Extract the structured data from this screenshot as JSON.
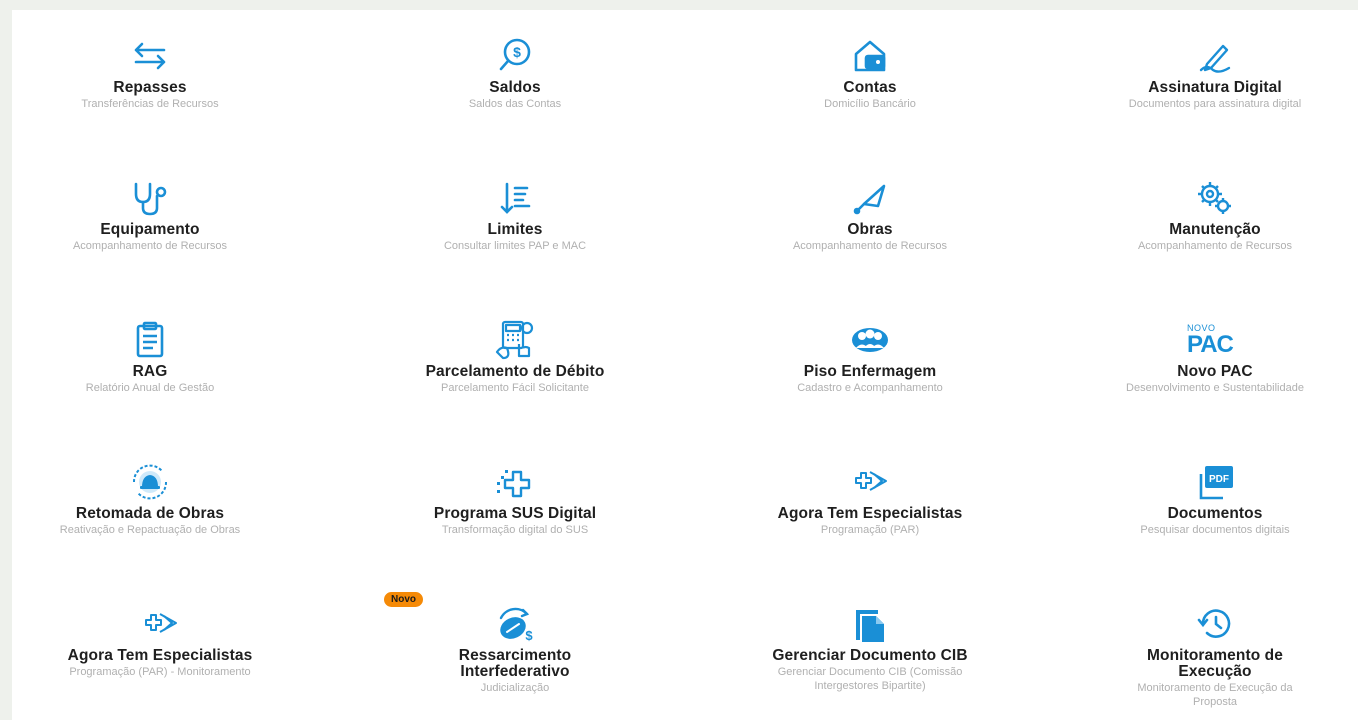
{
  "accent_color": "#1a8fd6",
  "badge": {
    "label": "Novo"
  },
  "tiles": [
    {
      "title": "Repasses",
      "subtitle": "Transferências de Recursos",
      "icon": "transfer-arrows-icon"
    },
    {
      "title": "Saldos",
      "subtitle": "Saldos das Contas",
      "icon": "balance-search-icon"
    },
    {
      "title": "Contas",
      "subtitle": "Domicílio Bancário",
      "icon": "house-wallet-icon"
    },
    {
      "title": "Assinatura Digital",
      "subtitle": "Documentos para assinatura digital",
      "icon": "signature-pen-icon"
    },
    {
      "title": "Equipamento",
      "subtitle": "Acompanhamento de Recursos",
      "icon": "stethoscope-icon"
    },
    {
      "title": "Limites",
      "subtitle": "Consultar limites PAP e MAC",
      "icon": "sort-list-icon"
    },
    {
      "title": "Obras",
      "subtitle": "Acompanhamento de Recursos",
      "icon": "trowel-icon"
    },
    {
      "title": "Manutenção",
      "subtitle": "Acompanhamento de Recursos",
      "icon": "gears-icon"
    },
    {
      "title": "RAG",
      "subtitle": "Relatório Anual de Gestão",
      "icon": "clipboard-icon"
    },
    {
      "title": "Parcelamento de Débito",
      "subtitle": "Parcelamento Fácil Solicitante",
      "icon": "calculator-money-icon"
    },
    {
      "title": "Piso Enfermagem",
      "subtitle": "Cadastro e Acompanhamento",
      "icon": "people-group-icon"
    },
    {
      "title": "Novo PAC",
      "subtitle": "Desenvolvimento e Sustentabilidade",
      "icon": "novo-pac-logo",
      "logo_top": "NOVO",
      "logo_main": "PAC"
    },
    {
      "title": "Retomada de Obras",
      "subtitle": "Reativação e Repactuação de Obras",
      "icon": "helmet-cycle-icon"
    },
    {
      "title": "Programa SUS Digital",
      "subtitle": "Transformação digital do SUS",
      "icon": "digital-health-cross-icon"
    },
    {
      "title": "Agora Tem Especialistas",
      "subtitle": "Programação (PAR)",
      "icon": "cross-arrow-icon"
    },
    {
      "title": "Documentos",
      "subtitle": "Pesquisar documentos digitais",
      "icon": "pdf-file-icon",
      "logo_text": "PDF"
    },
    {
      "title": "Agora Tem Especialistas",
      "subtitle": "Programação (PAR) - Monitoramento",
      "icon": "cross-arrow-icon"
    },
    {
      "title": "Ressarcimento Interfederativo",
      "subtitle": "Judicialização",
      "icon": "pill-refund-icon"
    },
    {
      "title": "Gerenciar Documento CIB",
      "subtitle": "Gerenciar Documento CIB (Comissão Intergestores Bipartite)",
      "icon": "document-icon"
    },
    {
      "title": "Monitoramento de Execução",
      "subtitle": "Monitoramento de Execução da Proposta",
      "icon": "history-clock-icon"
    }
  ]
}
